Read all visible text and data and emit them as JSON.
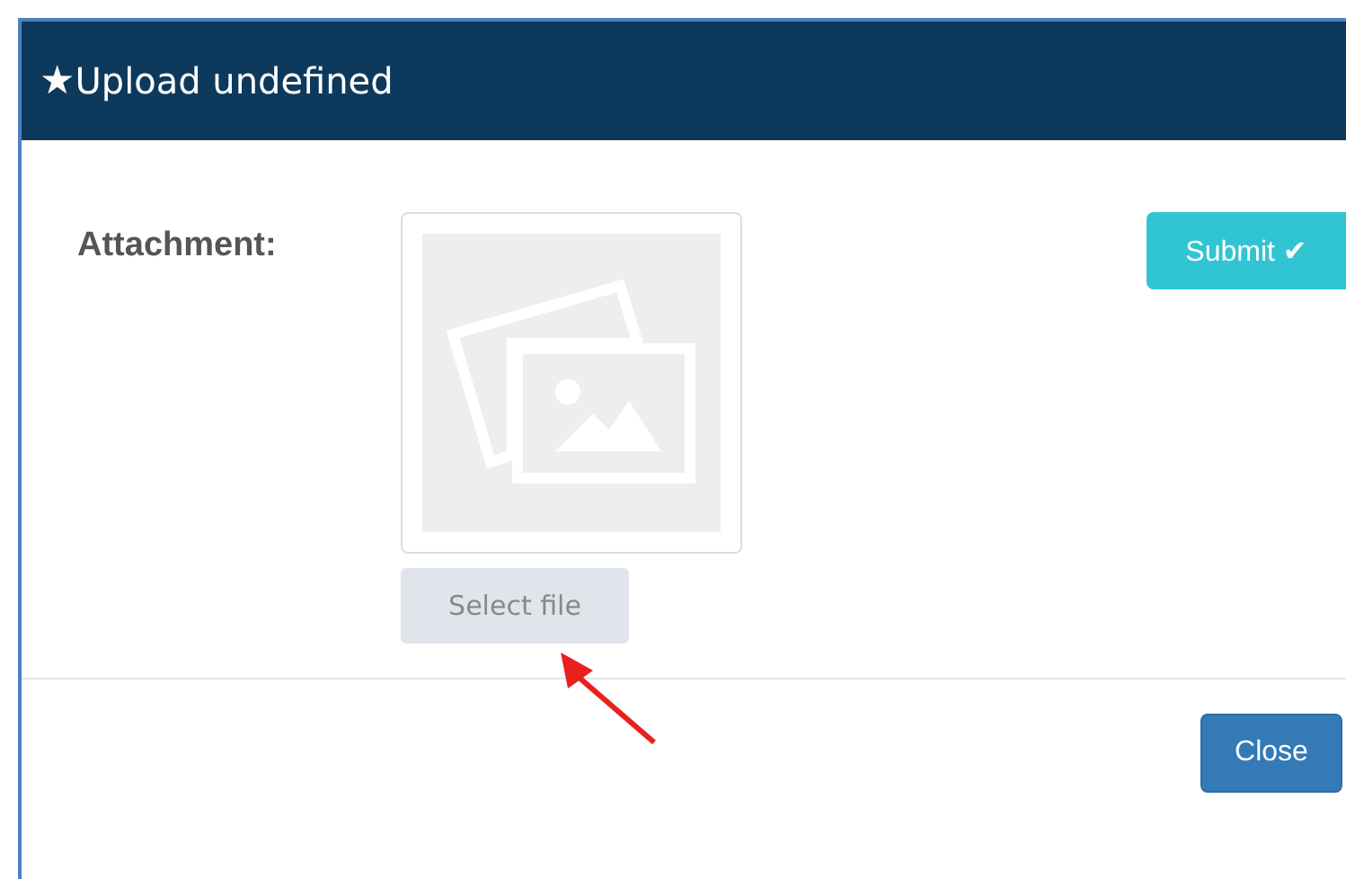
{
  "modal": {
    "title_icon": "★",
    "title": "Upload undefined"
  },
  "form": {
    "label": "Attachment:",
    "image": {
      "kind": "placeholder"
    },
    "select_button": "Select file",
    "submit_button": "Submit",
    "submit_icon": "✔"
  },
  "footer": {
    "close_button": "Close"
  }
}
